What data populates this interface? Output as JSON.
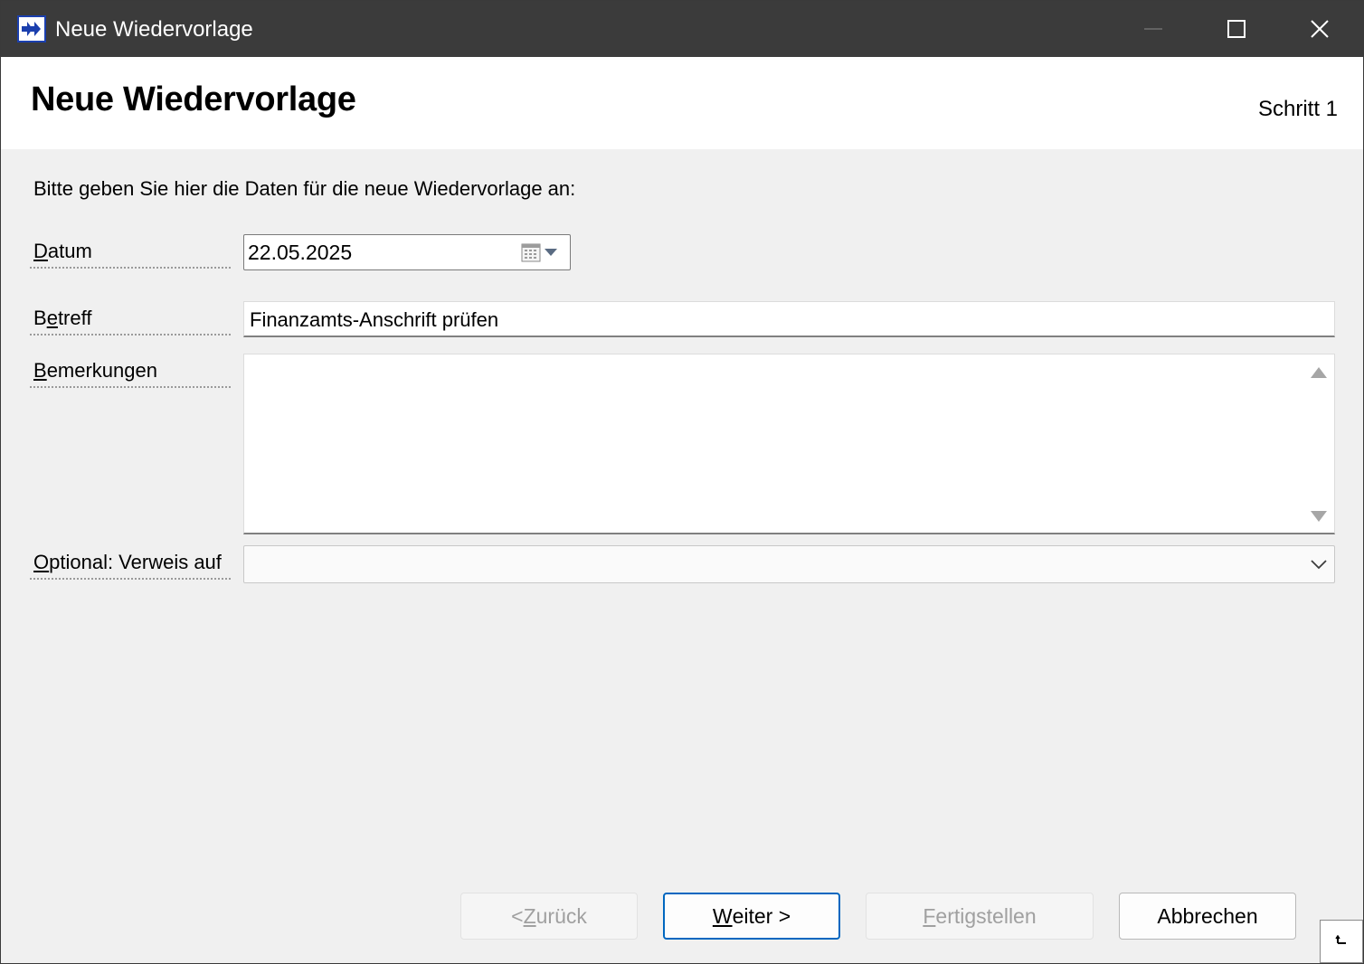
{
  "window": {
    "title": "Neue Wiedervorlage",
    "icon": "forward-arrows-icon"
  },
  "header": {
    "title": "Neue Wiedervorlage",
    "step": "Schritt 1"
  },
  "form": {
    "intro": "Bitte geben Sie hier die Daten für die neue Wiedervorlage an:",
    "datum": {
      "label_accel": "D",
      "label_rest": "atum",
      "value": "22.05.2025"
    },
    "betreff": {
      "label_pre": "B",
      "label_accel": "e",
      "label_rest": "treff",
      "value": "Finanzamts-Anschrift prüfen"
    },
    "bemerkungen": {
      "label_accel": "B",
      "label_rest": "emerkungen",
      "value": ""
    },
    "verweis": {
      "label_accel": "O",
      "label_rest": "ptional: Verweis auf",
      "value": ""
    }
  },
  "buttons": {
    "back": {
      "pre": "< ",
      "accel": "Z",
      "rest": "urück",
      "enabled": false
    },
    "next": {
      "pre": "",
      "accel": "W",
      "rest": "eiter >",
      "enabled": true
    },
    "finish": {
      "pre": "",
      "accel": "F",
      "rest": "ertigstellen",
      "enabled": false
    },
    "cancel": {
      "label": "Abbrechen",
      "enabled": true
    }
  },
  "colors": {
    "titlebar": "#3b3b3b",
    "focus_border": "#0067c0",
    "disabled_text": "#a0a0a0"
  }
}
